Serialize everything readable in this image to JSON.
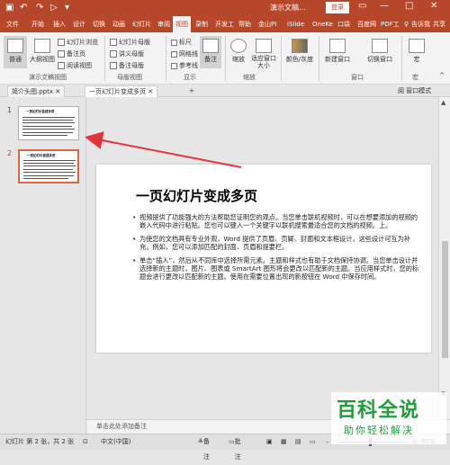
{
  "titlebar": {
    "quick_access": [
      "save",
      "undo",
      "redo",
      "present",
      "down"
    ],
    "title": "演示文稿...",
    "login": "登录",
    "window_controls": [
      "—",
      "□",
      "✕"
    ]
  },
  "menubar": {
    "tabs": [
      "文件",
      "开始",
      "插入",
      "设计",
      "切换",
      "动画",
      "幻灯片",
      "审阅",
      "视图",
      "录制",
      "开发工",
      "帮助",
      "金山PI",
      "iSlide",
      "OneKe",
      "口袋",
      "百度网",
      "PDF工",
      "♀",
      "告诉我",
      "共享"
    ],
    "active": "视图"
  },
  "ribbon": {
    "views": {
      "normal": "普通",
      "outline": "大纲视图",
      "slide_sorter": "幻灯片浏览",
      "notes_page": "备注页",
      "reading": "阅读视图",
      "group": "演示文稿视图"
    },
    "masters": {
      "slide_master": "幻灯片母版",
      "handout_master": "讲义母版",
      "notes_master": "备注母版",
      "group": "母版视图"
    },
    "show": {
      "ruler": "标尺",
      "gridlines": "网格线",
      "guides": "参考线",
      "notes": "备注",
      "group": "显示"
    },
    "zoom": {
      "zoom": "缩放",
      "fit": "适应窗口大小",
      "group": "缩放"
    },
    "color": {
      "label": "颜色/灰度"
    },
    "window": {
      "new_window": "新建窗口",
      "switch": "切换窗口",
      "group": "窗口"
    },
    "macro": {
      "label": "宏",
      "group": "宏"
    }
  },
  "doctabs": {
    "tab1": "简介头图.pptx",
    "tab2": "一页幻灯片变成多页",
    "right": "阅 窗口模式"
  },
  "thumbnails": [
    {
      "num": "1",
      "title": "一页幻灯片变成多页"
    },
    {
      "num": "2",
      "title": "一页幻灯片变成多页"
    }
  ],
  "slide": {
    "title": "一页幻灯片变成多页",
    "bullets": [
      "视频提供了功能强大的方法帮助您证明您的观点。当您单击联机视频时，可以在想要添加的视频的嵌入代码中进行粘贴。您也可以键入一个关键字以联机搜索最适合您的文档的视频。上。",
      "为使您的文档具有专业外观，Word 提供了页眉、页脚、封面和文本框设计，这些设计可互为补充。例如，您可以添加匹配的封面、页眉和提要栏。",
      "单击“插入”，然后从不同库中选择所需元素。主题和样式也有助于文档保持协调。当您单击设计并选择新的主题时，图片、图表或 SmartArt 图形将会更改以匹配新的主题。当应用样式时，您的标题会进行更改以匹配新的主题。使用在需要位置出现的新按钮在 Word 中保存时间。"
    ]
  },
  "notes": {
    "placeholder": "单击此处添加备注"
  },
  "statusbar": {
    "slide_info": "幻灯片 第 2 张，共 2 张",
    "language": "中文(中国)",
    "notes": "备注",
    "comments": "批注",
    "zoom": "50%"
  },
  "watermark": {
    "big": "百科全说",
    "small": "助你轻松解决"
  },
  "colors": {
    "accent": "#b7472a",
    "selection": "#e0663c",
    "arrow": "#e8323c",
    "watermark": "#1f9e3a"
  }
}
